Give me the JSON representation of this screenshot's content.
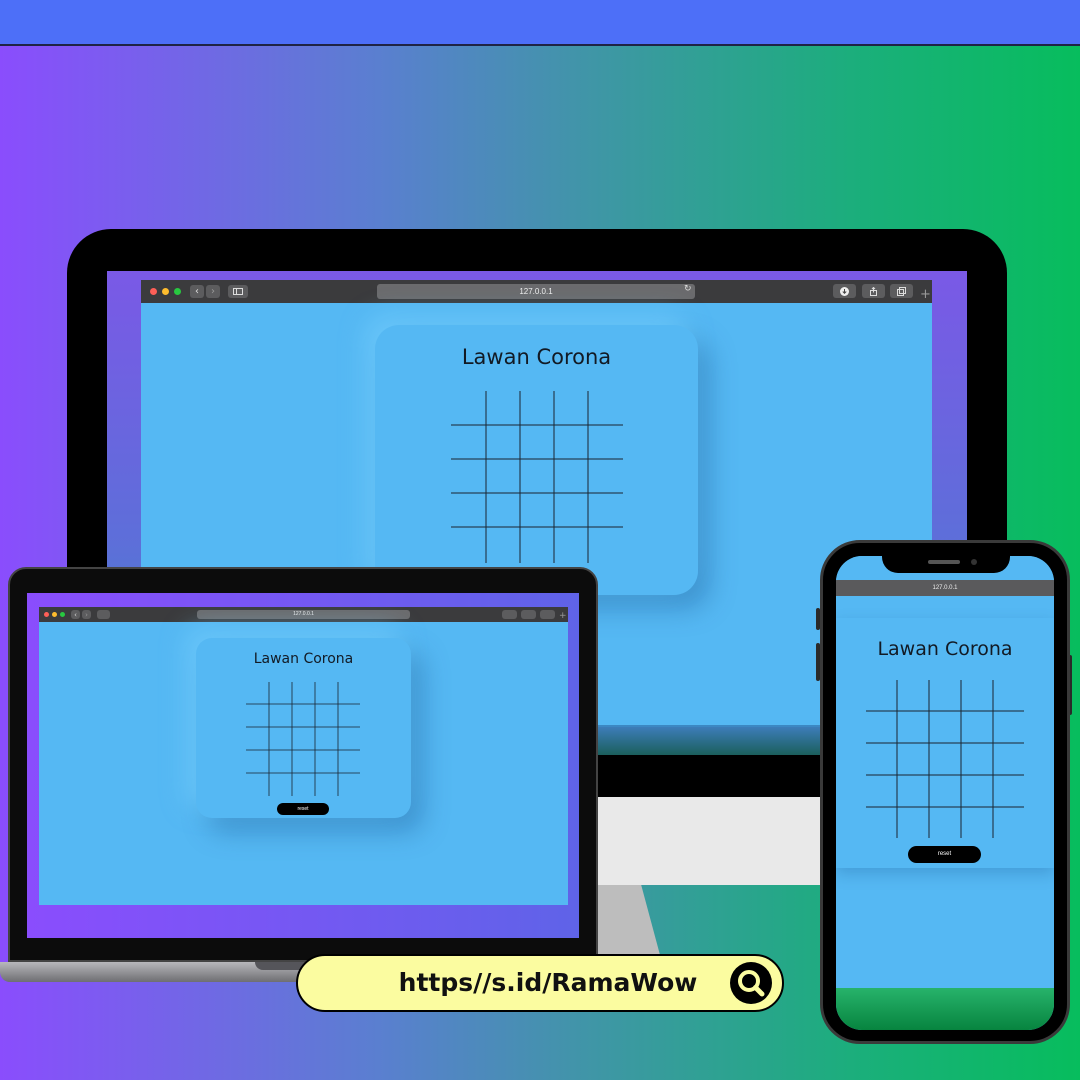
{
  "colors": {
    "page_bg_start": "#8a4dfd",
    "page_bg_end": "#07bd5d",
    "top_bar": "#4d6ff8",
    "app_bg": "#55b8f3",
    "browser_chrome": "#3b3b3d",
    "pill_bg": "#fbfca0"
  },
  "desktop": {
    "url": "127.0.0.1",
    "title": "Lawan Corona"
  },
  "laptop": {
    "url": "127.0.0.1",
    "title": "Lawan Corona",
    "reset_label": "reset"
  },
  "phone": {
    "url": "127.0.0.1",
    "title": "Lawan Corona",
    "reset_label": "reset"
  },
  "promo": {
    "link_text": "https//s.id/RamaWow",
    "icon": "search-icon"
  },
  "icons": [
    "close-dot",
    "minimize-dot",
    "maximize-dot",
    "back-icon",
    "forward-icon",
    "sidebar-icon",
    "reload-icon",
    "download-icon",
    "share-icon",
    "tabs-icon",
    "new-tab-icon"
  ]
}
